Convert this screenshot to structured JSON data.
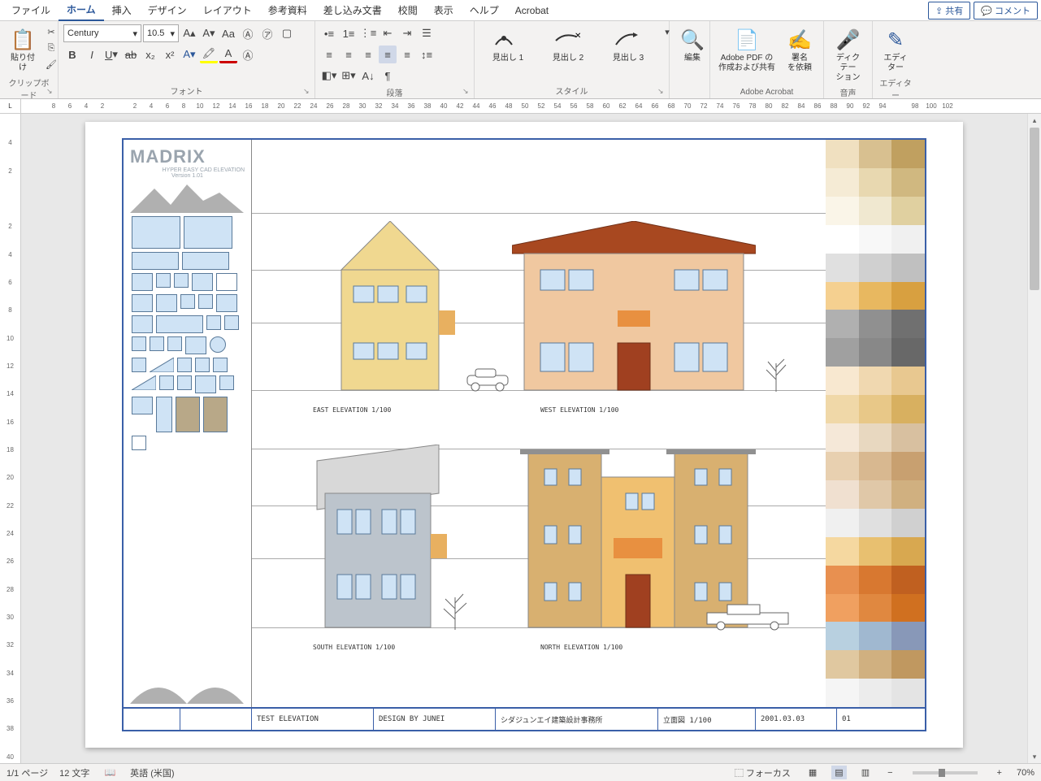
{
  "menu": {
    "file": "ファイル",
    "home": "ホーム",
    "insert": "挿入",
    "design": "デザイン",
    "layout": "レイアウト",
    "references": "参考資料",
    "mailings": "差し込み文書",
    "review": "校閲",
    "view": "表示",
    "help": "ヘルプ",
    "acrobat": "Acrobat",
    "share": "共有",
    "comments": "コメント"
  },
  "ribbon": {
    "clipboard": {
      "label": "クリップボード",
      "paste": "貼り付け"
    },
    "font": {
      "label": "フォント",
      "name": "Century",
      "size": "10.5"
    },
    "paragraph": {
      "label": "段落"
    },
    "styles": {
      "label": "スタイル",
      "h1": "見出し 1",
      "h2": "見出し 2",
      "h3": "見出し 3"
    },
    "editing": {
      "label": "編集"
    },
    "acrobat": {
      "label": "Adobe Acrobat",
      "create": "Adobe PDF の\n作成および共有",
      "sign": "署名\nを依頼"
    },
    "voice": {
      "label": "音声",
      "dictate": "ディクテー\nション"
    },
    "editor": {
      "label": "エディター",
      "btn": "エディ\nター"
    }
  },
  "doc": {
    "logo": {
      "name": "MADRIX",
      "sub": "HYPER EASY CAD ELEVATION",
      "ver": "Version 1.01"
    },
    "elev": {
      "east": "EAST ELEVATION 1/100",
      "west": "WEST ELEVATION 1/100",
      "south": "SOUTH ELEVATION 1/100",
      "north": "NORTH ELEVATION 1/100"
    },
    "titleblock": {
      "c1": "",
      "c2": "",
      "c3": "TEST  ELEVATION",
      "c4": "DESIGN  BY JUNEI",
      "c5": "シダジュンエイ建築設計事務所",
      "c6": "立面図 1/100",
      "c7": "2001.03.03",
      "c8": "01"
    }
  },
  "ruler_h": [
    "8",
    "6",
    "4",
    "2",
    "",
    "2",
    "4",
    "6",
    "8",
    "10",
    "12",
    "14",
    "16",
    "18",
    "20",
    "22",
    "24",
    "26",
    "28",
    "30",
    "32",
    "34",
    "36",
    "38",
    "40",
    "42",
    "44",
    "46",
    "48",
    "50",
    "52",
    "54",
    "56",
    "58",
    "60",
    "62",
    "64",
    "66",
    "68",
    "70",
    "72",
    "74",
    "76",
    "78",
    "80",
    "82",
    "84",
    "86",
    "88",
    "90",
    "92",
    "94",
    "",
    "98",
    "100",
    "102"
  ],
  "ruler_v": [
    "",
    "4",
    "",
    "2",
    "",
    "",
    "",
    "2",
    "",
    "4",
    "",
    "6",
    "",
    "8",
    "",
    "10",
    "",
    "12",
    "",
    "14",
    "",
    "16",
    "",
    "18",
    "",
    "20",
    "",
    "22",
    "",
    "24",
    "",
    "26",
    "",
    "28",
    "",
    "30",
    "",
    "32",
    "",
    "34",
    "",
    "36",
    "",
    "38",
    "",
    "40"
  ],
  "status": {
    "page": "1/1 ページ",
    "words": "12 文字",
    "lang": "英語 (米国)",
    "focus": "フォーカス",
    "zoom": "70%"
  },
  "swatches": [
    [
      "#f0e0c0",
      "#d8c090",
      "#c0a060"
    ],
    [
      "#f5ebd5",
      "#e8d8b0",
      "#d0b880"
    ],
    [
      "#faf5e8",
      "#f0e8d0",
      "#e0d0a0"
    ],
    [
      "#ffffff",
      "#f8f8f8",
      "#f0f0f0"
    ],
    [
      "#e0e0e0",
      "#d0d0d0",
      "#c0c0c0"
    ],
    [
      "#f5d090",
      "#e8b860",
      "#d8a040"
    ],
    [
      "#b0b0b0",
      "#909090",
      "#707070"
    ],
    [
      "#a0a0a0",
      "#888888",
      "#686868"
    ],
    [
      "#f8e8d0",
      "#f0d8b0",
      "#e8c890"
    ],
    [
      "#f0d8a8",
      "#e8c888",
      "#d8b060"
    ],
    [
      "#f5e8d8",
      "#e8d8c0",
      "#d8c0a0"
    ],
    [
      "#e8d0b0",
      "#d8b890",
      "#c8a070"
    ],
    [
      "#f0e0d0",
      "#e0c8a8",
      "#d0b080"
    ],
    [
      "#f0f0f0",
      "#e0e0e0",
      "#d0d0d0"
    ],
    [
      "#f5d8a0",
      "#e8c070",
      "#d8a850"
    ],
    [
      "#e89050",
      "#d87830",
      "#c06020"
    ],
    [
      "#f0a060",
      "#e08840",
      "#d07020"
    ],
    [
      "#b8d0e0",
      "#a0b8d0",
      "#8898b8"
    ],
    [
      "#e0c8a0",
      "#d0b080",
      "#c09860"
    ],
    [
      "#f5f5f5",
      "#ececec",
      "#e4e4e4"
    ]
  ]
}
